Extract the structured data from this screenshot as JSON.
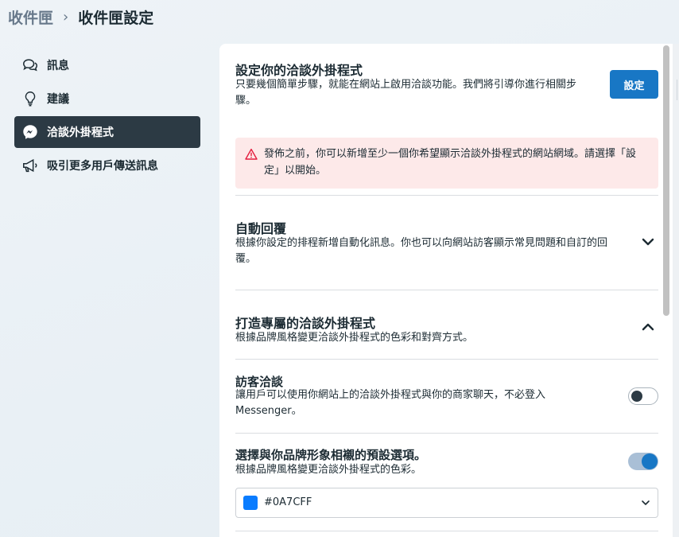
{
  "breadcrumb": {
    "parent": "收件匣",
    "separator": "›",
    "current": "收件匣設定"
  },
  "sidebar": {
    "items": [
      {
        "label": "訊息",
        "icon": "chat-bubbles-icon",
        "active": false
      },
      {
        "label": "建議",
        "icon": "lightbulb-icon",
        "active": false
      },
      {
        "label": "洽談外掛程式",
        "icon": "messenger-icon",
        "active": true
      },
      {
        "label": "吸引更多用戶傳送訊息",
        "icon": "megaphone-icon",
        "active": false
      }
    ]
  },
  "setup": {
    "title": "設定你的洽談外掛程式",
    "description": "只要幾個簡單步驟，就能在網站上啟用洽談功能。我們將引導你進行相關步驟。",
    "button_label": "設定"
  },
  "warning": {
    "icon": "warning-triangle-icon",
    "text": "發佈之前，你可以新增至少一個你希望顯示洽談外掛程式的網站網域。請選擇「設定」以開始。"
  },
  "auto_reply": {
    "title": "自動回覆",
    "description": "根據你設定的排程新增自動化訊息。你也可以向網站訪客顯示常見問題和自訂的回覆。",
    "expanded": false
  },
  "customize": {
    "title": "打造專屬的洽談外掛程式",
    "description": "根據品牌風格變更洽談外掛程式的色彩和對齊方式。",
    "expanded": true,
    "visitor_chat": {
      "title": "訪客洽談",
      "description": "讓用戶可以使用你網站上的洽談外掛程式與你的商家聊天，不必登入 Messenger。",
      "enabled": false
    },
    "brand_preset": {
      "title": "選擇與你品牌形象相襯的預設選項。",
      "description": "根據品牌風格變更洽談外掛程式的色彩。",
      "enabled": true,
      "selected_color": "#0A7CFF"
    }
  },
  "colors": {
    "accent": "#1877c5",
    "swatch": "#0A7CFF",
    "sidebar_active": "#2c3a44",
    "warning_bg": "#fde9e9",
    "warning_icon": "#e41e3f"
  }
}
